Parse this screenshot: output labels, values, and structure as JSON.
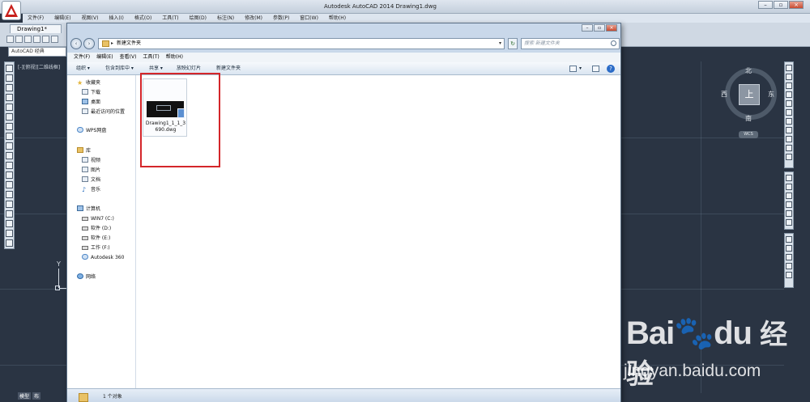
{
  "acad": {
    "title": "Autodesk AutoCAD 2014    Drawing1.dwg",
    "menu": [
      "文件(F)",
      "编辑(E)",
      "视图(V)",
      "插入(I)",
      "格式(O)",
      "工具(T)",
      "绘图(D)",
      "标注(N)",
      "修改(M)",
      "参数(P)",
      "窗口(W)",
      "帮助(H)"
    ],
    "drawing_tab": "Drawing1*",
    "workspace": "AutoCAD 经典",
    "viewport_label": "[-][俯视][二维线框]",
    "ucs_y": "Y",
    "layout_tabs": [
      "模型",
      "布"
    ]
  },
  "viewcube": {
    "north": "北",
    "south": "南",
    "east": "东",
    "west": "西",
    "face": "上",
    "wcs": "WCS"
  },
  "explorer": {
    "address": "新建文件夹",
    "search_placeholder": "搜索 新建文件夹",
    "menu": [
      "文件(F)",
      "编辑(E)",
      "查看(V)",
      "工具(T)",
      "帮助(H)"
    ],
    "toolbar": {
      "organize": "组织 ▾",
      "include_library": "包含到库中 ▾",
      "share": "共享 ▾",
      "slideshow": "放映幻灯片",
      "new_folder": "新建文件夹"
    },
    "nav": {
      "favorites": "收藏夹",
      "downloads": "下载",
      "desktop": "桌面",
      "recent": "最近访问的位置",
      "wps": "WPS网盘",
      "library": "库",
      "videos": "视频",
      "pictures": "图片",
      "documents": "文档",
      "music": "音乐",
      "computer": "计算机",
      "win7": "WIN7 (C:)",
      "soft_d": "软件 (D:)",
      "soft_e": "软件 (E:)",
      "work_f": "工作 (F:)",
      "a360": "Autodesk 360",
      "network": "网络"
    },
    "file_name": "Drawing1_1_1_3690.dwg",
    "status": "1 个对象"
  },
  "watermark": {
    "logo": "Bai",
    "logo_du": "du",
    "logo_cn": "经验",
    "url": "jingyan.baidu.com"
  }
}
